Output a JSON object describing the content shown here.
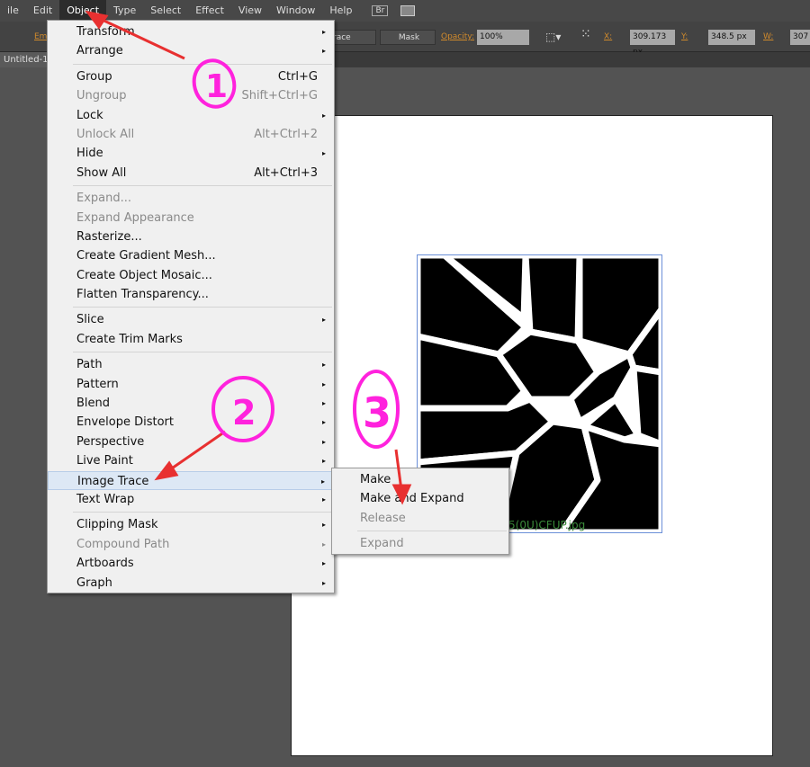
{
  "menubar": [
    "ile",
    "Edit",
    "Object",
    "Type",
    "Select",
    "Effect",
    "View",
    "Window",
    "Help"
  ],
  "menubar_extra": {
    "bridge": "Br"
  },
  "control": {
    "left_label": "Em",
    "trace_label": "race",
    "mask": "Mask",
    "opacity_label": "Opacity:",
    "opacity": "100%",
    "x_label": "X:",
    "x": "309.173 px",
    "y_label": "Y:",
    "y": "348.5 px",
    "w_label": "W:",
    "w": "307"
  },
  "document_tab": "Untitled-1*",
  "filename": "5(0U)CFUP.jpg",
  "object_menu": [
    {
      "label": "Transform",
      "arrow": true
    },
    {
      "label": "Arrange",
      "arrow": true
    },
    {
      "sep": true
    },
    {
      "label": "Group",
      "shortcut": "Ctrl+G"
    },
    {
      "label": "Ungroup",
      "shortcut": "Shift+Ctrl+G",
      "disabled": true
    },
    {
      "label": "Lock",
      "arrow": true
    },
    {
      "label": "Unlock All",
      "shortcut": "Alt+Ctrl+2",
      "disabled": true
    },
    {
      "label": "Hide",
      "arrow": true
    },
    {
      "label": "Show All",
      "shortcut": "Alt+Ctrl+3"
    },
    {
      "sep": true
    },
    {
      "label": "Expand...",
      "disabled": true
    },
    {
      "label": "Expand Appearance",
      "disabled": true
    },
    {
      "label": "Rasterize..."
    },
    {
      "label": "Create Gradient Mesh..."
    },
    {
      "label": "Create Object Mosaic..."
    },
    {
      "label": "Flatten Transparency..."
    },
    {
      "sep": true
    },
    {
      "label": "Slice",
      "arrow": true
    },
    {
      "label": "Create Trim Marks"
    },
    {
      "sep": true
    },
    {
      "label": "Path",
      "arrow": true
    },
    {
      "label": "Pattern",
      "arrow": true
    },
    {
      "label": "Blend",
      "arrow": true
    },
    {
      "label": "Envelope Distort",
      "arrow": true
    },
    {
      "label": "Perspective",
      "arrow": true
    },
    {
      "label": "Live Paint",
      "arrow": true
    },
    {
      "label": "Image Trace",
      "arrow": true,
      "highlighted": true
    },
    {
      "label": "Text Wrap",
      "arrow": true
    },
    {
      "sep": true
    },
    {
      "label": "Clipping Mask",
      "arrow": true
    },
    {
      "label": "Compound Path",
      "arrow": true,
      "disabled": true
    },
    {
      "label": "Artboards",
      "arrow": true
    },
    {
      "label": "Graph",
      "arrow": true
    }
  ],
  "image_trace_submenu": [
    {
      "label": "Make"
    },
    {
      "label": "Make and Expand"
    },
    {
      "label": "Release",
      "disabled": true
    },
    {
      "sep": true
    },
    {
      "label": "Expand",
      "disabled": true
    }
  ],
  "annotations": {
    "n1": "1",
    "n2": "2",
    "n3": "3",
    "color": "#ff22dd",
    "arrow_color": "#e83030"
  }
}
